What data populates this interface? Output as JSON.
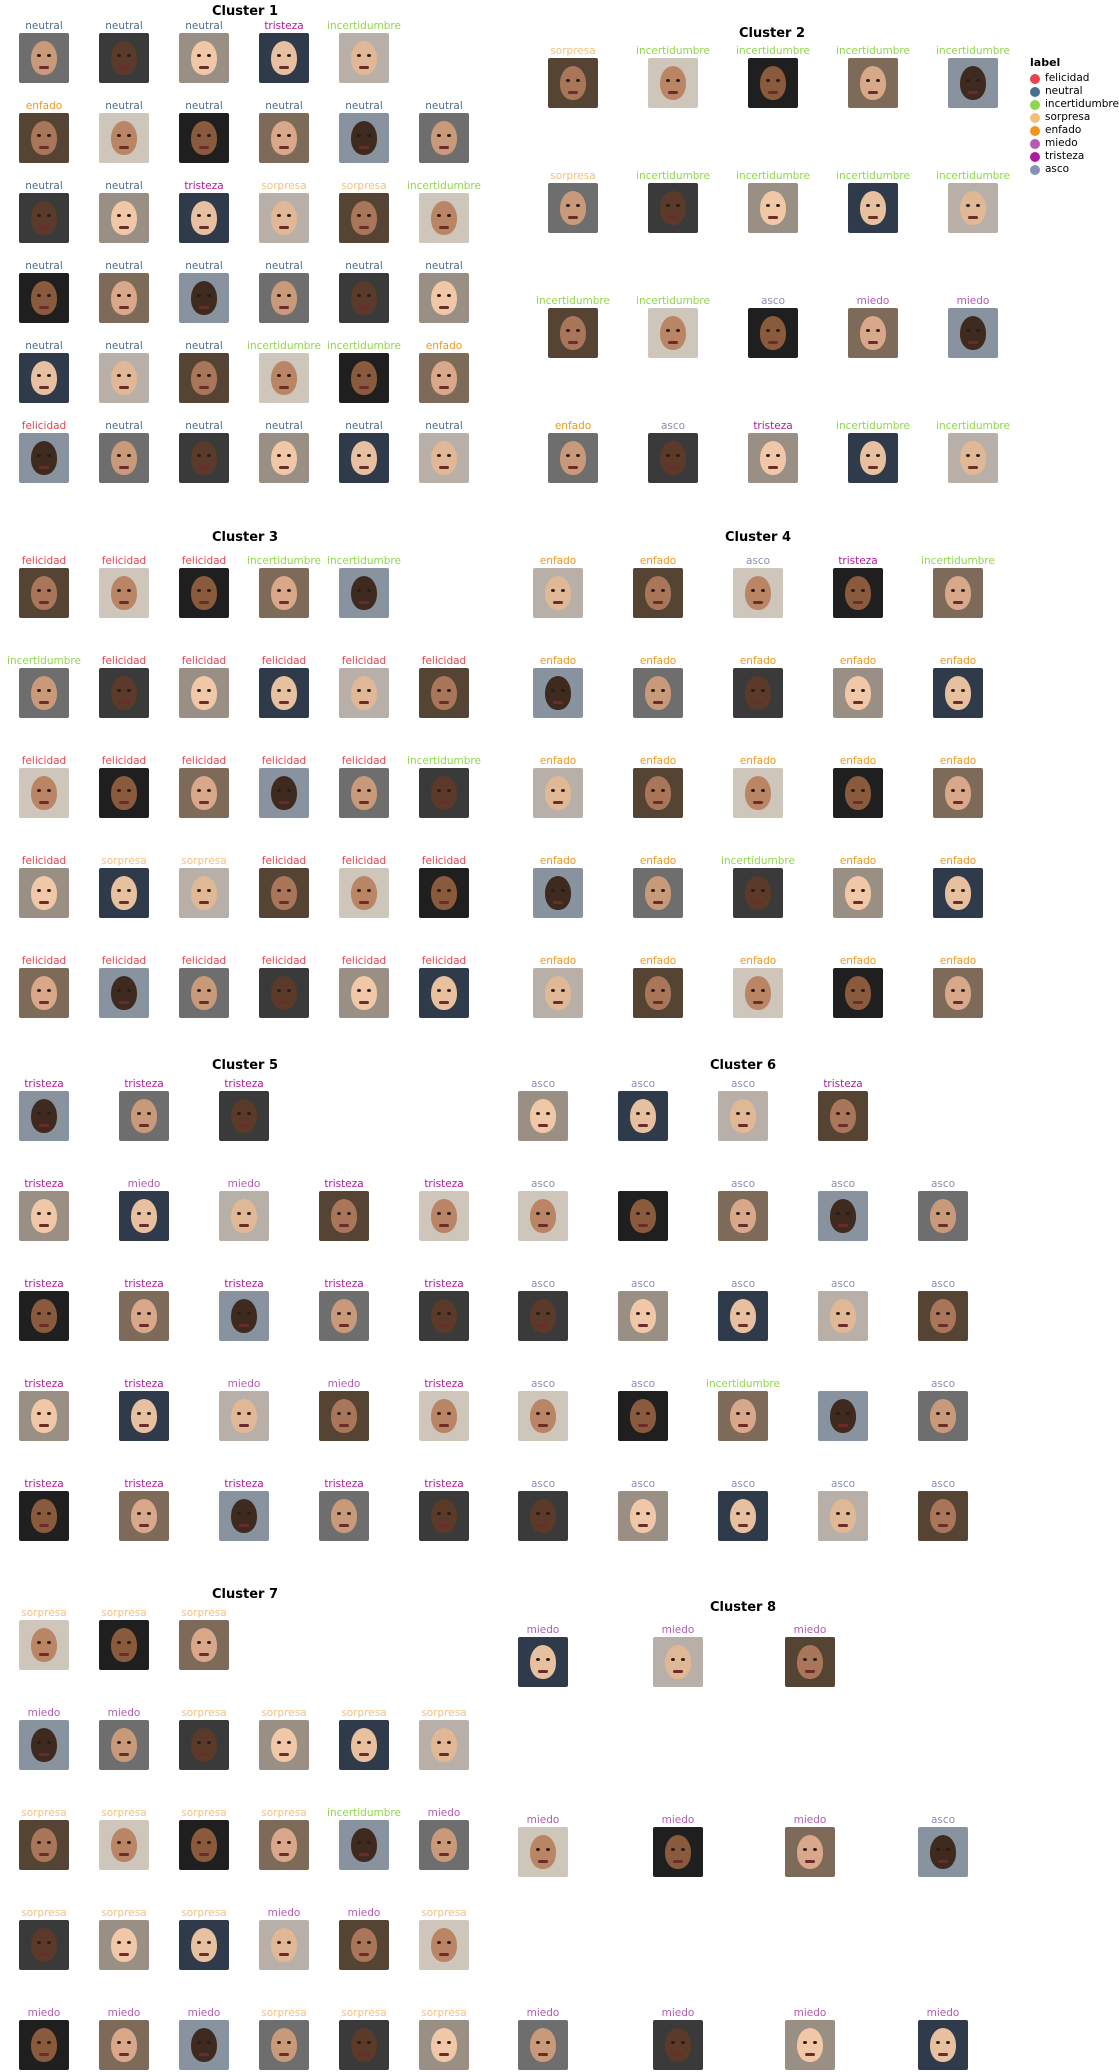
{
  "legend": {
    "title": "label",
    "items": [
      {
        "name": "felicidad",
        "color": "#e8434e"
      },
      {
        "name": "neutral",
        "color": "#4a6e92"
      },
      {
        "name": "incertidumbre",
        "color": "#8fd64a"
      },
      {
        "name": "sorpresa",
        "color": "#f2c07d"
      },
      {
        "name": "enfado",
        "color": "#f0961b"
      },
      {
        "name": "miedo",
        "color": "#b25bb0"
      },
      {
        "name": "tristeza",
        "color": "#b0199a"
      },
      {
        "name": "asco",
        "color": "#8a8fb4"
      }
    ]
  },
  "clusters": [
    {
      "title": "Cluster 1",
      "rows": [
        [
          "neutral",
          "neutral",
          "neutral",
          "tristeza",
          "incertidumbre"
        ],
        [
          "enfado",
          "neutral",
          "neutral",
          "neutral",
          "neutral",
          "neutral"
        ],
        [
          "neutral",
          "neutral",
          "tristeza",
          "sorpresa",
          "sorpresa",
          "incertidumbre"
        ],
        [
          "neutral",
          "neutral",
          "neutral",
          "neutral",
          "neutral",
          "neutral"
        ],
        [
          "neutral",
          "neutral",
          "neutral",
          "incertidumbre",
          "incertidumbre",
          "enfado"
        ],
        [
          "felicidad",
          "neutral",
          "neutral",
          "neutral",
          "neutral",
          "neutral"
        ]
      ]
    },
    {
      "title": "Cluster 2",
      "rows": [
        [
          "sorpresa",
          "incertidumbre",
          "incertidumbre",
          "incertidumbre",
          "incertidumbre"
        ],
        [
          "sorpresa",
          "incertidumbre",
          "incertidumbre",
          "incertidumbre",
          "incertidumbre"
        ],
        [
          "incertidumbre",
          "incertidumbre",
          "asco",
          "miedo",
          "miedo"
        ],
        [
          "enfado",
          "asco",
          "tristeza",
          "incertidumbre",
          "incertidumbre"
        ]
      ]
    },
    {
      "title": "Cluster 3",
      "rows": [
        [
          "felicidad",
          "felicidad",
          "felicidad",
          "incertidumbre",
          "incertidumbre"
        ],
        [
          "incertidumbre",
          "felicidad",
          "felicidad",
          "felicidad",
          "felicidad",
          "felicidad"
        ],
        [
          "felicidad",
          "felicidad",
          "felicidad",
          "felicidad",
          "felicidad",
          "incertidumbre"
        ],
        [
          "felicidad",
          "sorpresa",
          "sorpresa",
          "felicidad",
          "felicidad",
          "felicidad"
        ],
        [
          "felicidad",
          "felicidad",
          "felicidad",
          "felicidad",
          "felicidad",
          "felicidad"
        ]
      ]
    },
    {
      "title": "Cluster 4",
      "rows": [
        [
          "enfado",
          "enfado",
          "asco",
          "tristeza",
          "incertidumbre"
        ],
        [
          "enfado",
          "enfado",
          "enfado",
          "enfado",
          "enfado"
        ],
        [
          "enfado",
          "enfado",
          "enfado",
          "enfado",
          "enfado"
        ],
        [
          "enfado",
          "enfado",
          "incertidumbre",
          "enfado",
          "enfado"
        ],
        [
          "enfado",
          "enfado",
          "enfado",
          "enfado",
          "enfado"
        ]
      ]
    },
    {
      "title": "Cluster 5",
      "rows": [
        [
          "tristeza",
          "tristeza",
          "tristeza"
        ],
        [
          "tristeza",
          "miedo",
          "miedo",
          "tristeza",
          "tristeza"
        ],
        [
          "tristeza",
          "tristeza",
          "tristeza",
          "tristeza",
          "tristeza"
        ],
        [
          "tristeza",
          "tristeza",
          "miedo",
          "miedo",
          "tristeza"
        ],
        [
          "tristeza",
          "tristeza",
          "tristeza",
          "tristeza",
          "tristeza"
        ]
      ]
    },
    {
      "title": "Cluster 6",
      "rows": [
        [
          "asco",
          "asco",
          "asco",
          "tristeza"
        ],
        [
          "asco",
          "",
          "asco",
          "asco",
          "asco"
        ],
        [
          "asco",
          "asco",
          "asco",
          "asco",
          "asco"
        ],
        [
          "asco",
          "asco",
          "incertidumbre",
          "",
          "asco"
        ],
        [
          "asco",
          "asco",
          "asco",
          "asco",
          "asco"
        ]
      ]
    },
    {
      "title": "Cluster 7",
      "rows": [
        [
          "sorpresa",
          "sorpresa",
          "sorpresa"
        ],
        [
          "miedo",
          "miedo",
          "sorpresa",
          "sorpresa",
          "sorpresa",
          "sorpresa"
        ],
        [
          "sorpresa",
          "sorpresa",
          "sorpresa",
          "sorpresa",
          "incertidumbre",
          "miedo"
        ],
        [
          "sorpresa",
          "sorpresa",
          "sorpresa",
          "miedo",
          "miedo",
          "sorpresa"
        ],
        [
          "miedo",
          "miedo",
          "miedo",
          "sorpresa",
          "sorpresa",
          "sorpresa"
        ]
      ]
    },
    {
      "title": "Cluster 8",
      "rows": [
        [
          "miedo",
          "miedo",
          "miedo"
        ],
        [
          "miedo",
          "miedo",
          "miedo",
          "asco"
        ],
        [
          "miedo",
          "miedo",
          "miedo",
          "miedo"
        ]
      ]
    }
  ]
}
